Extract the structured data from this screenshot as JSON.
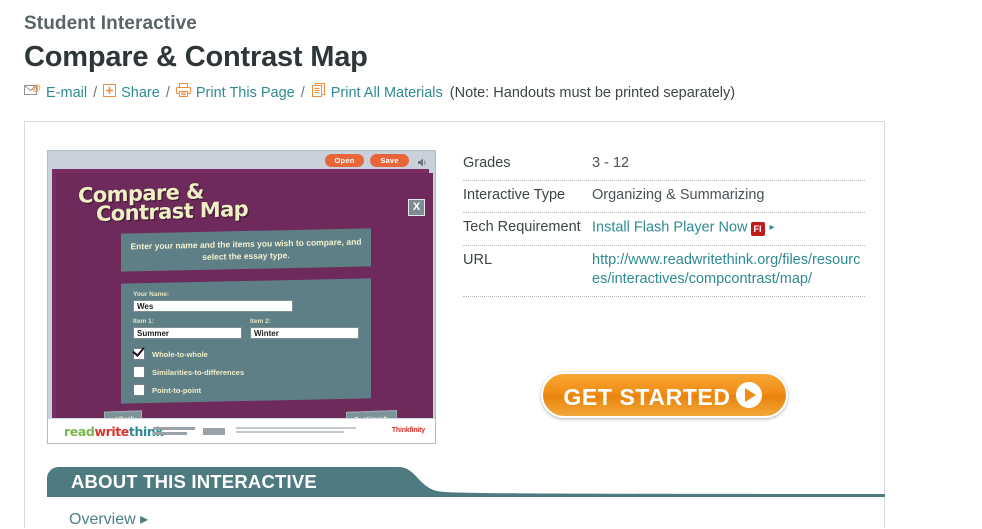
{
  "header": {
    "kicker": "Student Interactive",
    "title": "Compare & Contrast Map"
  },
  "action_bar": {
    "email_label": "E-mail",
    "share_label": "Share",
    "print_page_label": "Print This Page",
    "print_all_label": "Print All Materials",
    "note": "(Note: Handouts must be printed separately)",
    "separator": "/"
  },
  "preview": {
    "open_label": "Open",
    "save_label": "Save",
    "close_label": "X",
    "title_line1": "Compare &",
    "title_line2": "Contrast Map",
    "prompt": "Enter your name and the items you wish to compare, and select the essay type.",
    "fields": {
      "name_label": "Your Name:",
      "name_value": "Wes",
      "item1_label": "Item 1:",
      "item1_value": "Summer",
      "item2_label": "Item 2:",
      "item2_value": "Winter"
    },
    "options": [
      {
        "label": "Whole-to-whole",
        "checked": true
      },
      {
        "label": "Similarities-to-differences",
        "checked": false
      },
      {
        "label": "Point-to-point",
        "checked": false
      }
    ],
    "back_label": "Back",
    "continue_label": "Continue",
    "logo": {
      "part1": "read",
      "part2": "write",
      "part3": "think"
    },
    "footer_partner": "Thinkfinity"
  },
  "meta": {
    "rows": [
      {
        "key": "Grades",
        "value": "3 - 12",
        "type": "text"
      },
      {
        "key": "Interactive Type",
        "value": "Organizing & Summarizing",
        "type": "text"
      },
      {
        "key": "Tech Requirement",
        "value": "Install Flash Player Now",
        "type": "link-flash",
        "badge": "Fl",
        "arrow": "▸"
      },
      {
        "key": "URL",
        "value": "http://www.readwritethink.org/files/resources/interactives/compcontrast/map/",
        "type": "link"
      }
    ]
  },
  "cta": {
    "get_started_label": "GET STARTED"
  },
  "about": {
    "heading": "ABOUT THIS INTERACTIVE",
    "overview_label": "Overview ▸"
  },
  "colors": {
    "teal_link": "#2f8a92",
    "teal_bar": "#4d7b80",
    "orange_icon": "#ef8d3a",
    "orange_button": "#f08c15",
    "flash_red": "#c01b1b",
    "purple_stage": "#6e2a5b",
    "slate_panel": "#5e7f85"
  }
}
